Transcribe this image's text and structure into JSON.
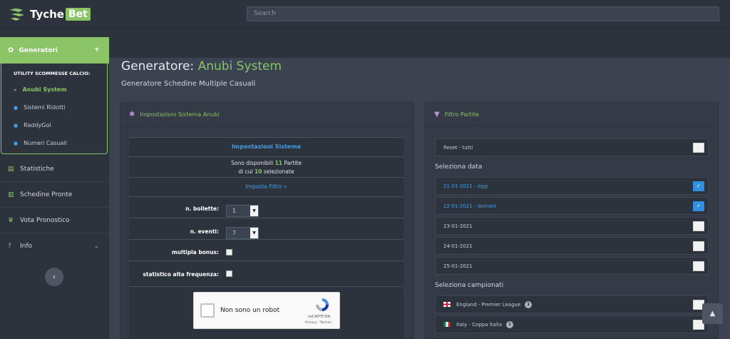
{
  "brand": {
    "name": "Tyche",
    "suffix": "Bet"
  },
  "search": {
    "placeholder": "Search"
  },
  "sidebar": {
    "generatori": {
      "label": "Generatori",
      "section_title": "UTILITY SCOMMESSE CALCIO:",
      "items": [
        {
          "label": "Anubi System",
          "active": true
        },
        {
          "label": "Sistemi Ridotti"
        },
        {
          "label": "RaddyGol"
        },
        {
          "label": "Numeri Casuali"
        }
      ]
    },
    "nav": [
      {
        "label": "Statistiche",
        "icon": "chart-icon"
      },
      {
        "label": "Schedine Pronte",
        "icon": "ticket-icon"
      },
      {
        "label": "Vota Pronostico",
        "icon": "trophy-icon"
      },
      {
        "label": "Info",
        "icon": "question-icon"
      }
    ],
    "collapse_glyph": "‹"
  },
  "page": {
    "title_prefix": "Generatore:",
    "title_accent": "Anubi System",
    "subtitle": "Generatore Schedine Multiple Casuali"
  },
  "settings_panel": {
    "title": "Impostazioni Sistema Anubi",
    "table_title": "Impostazioni Sistema",
    "available_prefix": "Sono disponibili",
    "available_count": "11",
    "available_suffix": "Partite",
    "selected_prefix": "di cui",
    "selected_count": "10",
    "selected_suffix": "selezionate",
    "filter_link": "Imposta Filtro »",
    "fields": {
      "bollette_label": "n. bollette:",
      "bollette_value": "1",
      "eventi_label": "n. eventi:",
      "eventi_value": "7",
      "bonus_label": "multipla bonus:",
      "statistico_label": "statistico alta frequenza:"
    },
    "captcha": {
      "label": "Non sono un robot",
      "brand": "reCAPTCHA",
      "terms": "Privacy - Termini"
    }
  },
  "filter_panel": {
    "title": "Filtro Partite",
    "reset_label": "Reset - tutti",
    "date_section": "Seleziona data",
    "dates": [
      {
        "label": "21-01-2021 - oggi",
        "checked": true
      },
      {
        "label": "22-01-2021 - domani",
        "checked": true
      },
      {
        "label": "23-01-2021",
        "checked": false
      },
      {
        "label": "24-01-2021",
        "checked": false
      },
      {
        "label": "25-01-2021",
        "checked": false
      }
    ],
    "league_section": "Seleziona campionati",
    "leagues": [
      {
        "label": "England - Premier League",
        "count": "1"
      },
      {
        "label": "Italy - Coppa Italia",
        "count": "1"
      }
    ]
  },
  "colors": {
    "accent": "#8ac467",
    "link": "#3ea0e6",
    "background": "#3b4350",
    "panel": "#343b46"
  }
}
